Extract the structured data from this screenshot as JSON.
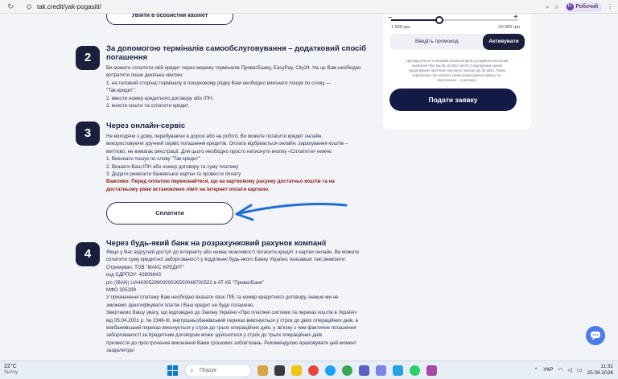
{
  "browser": {
    "url": "tak.credit/yak-pogasiti/",
    "profile_initial": "Н",
    "profile_label": "Робочий"
  },
  "top_button_label": "Увійти в особистий кабінет",
  "steps": [
    {
      "number": "2",
      "title_line1": "За допомогою терміналів самообслуговування – додатковий спосіб",
      "title_line2": "погашення",
      "lines": [
        "Ви можете сплатити свій кредит через мережу терміналів ПриватБанку, EasyPay, City24. На це Вам необхідно",
        "витратити лише декілька хвилин:",
        "1. на головній сторінці терміналу в пошуковому рядку Вам необхідно виконати пошук по слову —",
        "\"Так.кредит\";",
        "2. ввести номер кредитного договору або ІПН;",
        "3. внести кошти та сплатити кредит."
      ]
    },
    {
      "number": "3",
      "title_line1": "Через онлайн-сервіс",
      "lines": [
        "Не виходячи з дому, перебуваючи в дорозі або на роботі, Ви можете погасити кредит онлайн,",
        "використовуючи зручний сервіс погашення кредитів. Оплата відбувається онлайн, зарахування коштів –",
        "миттєво, не вимагає реєстрації. Для цього необхідно просто натиснути кнопку «Сплатити» нижче:",
        "1. Виконати пошук по слову \"Так кредит\"",
        "2. Вказати Ваш ІПН або номер договору та суму платежу",
        "3. Додати реквізити банківської картки та провести оплату"
      ],
      "warning_line1": "Важливо: Перед оплатою переконайтеся, що на картковому рахунку достатньо коштів та на",
      "warning_line2": "достатньому рівні встановлено ліміт на інтернет оплати карткою.",
      "pay_button": "Сплатити"
    },
    {
      "number": "4",
      "title_line1": "Через будь-який банк на розрахунковий рахунок компанії",
      "lines": [
        "Якщо у Вас відсутній доступ до інтернету або немає можливості погасити кредит з картки онлайн, Ви можете",
        "сплатити суму кредитної заборгованості у відділенні будь-якого Банку України, вказавши такі реквізити:",
        "Отримувач: ТОВ \"МАКС КРЕДИТ\"",
        "код ЄДРПОУ: 42806643",
        "р/с (IBAN) UA443052990000026500046700522 в АТ КБ \"ПриватБанк\"",
        "МФО 305299",
        "У призначенні платежу Вам необхідно вказати своє ПІБ та номер кредитного договору, інакше ми не",
        "зможемо ідентифікувати платіж і Ваш кредит не буде погашено.",
        "Звертаємо Вашу увагу, що відповідно до Закону України «Про платіжні системи та переказ коштів в Україні»",
        "від 05.04.2001 р. № 2346-ІІІ, внутрішньобанківський переказ виконується у строк до двох операційних днів, а",
        "міжбанківський переказ виконується у строк до трьох операційних днів, у зв'язку з чим фактичне погашення",
        "заборгованості за Кредитним договором може здійснитися у строк до трьох операційних днів",
        "призвести до прострочення виконання Вами грошових зобов'язань. Рекомендуємо враховувати цей момент",
        "заздалегідь!"
      ]
    }
  ],
  "card": {
    "range_min": "1 000 грн",
    "range_max": "10 000 грн",
    "slider_value_fraction": 0.38,
    "promo_label": "Введіть промокод",
    "promo_button": "Активувати",
    "disclaimer_lines": [
      "Цей відсоток не є кінцевим калькулятором у розумінні постанови",
      "правління НБУ від 05.10.2021 №100 та відображає умови",
      "кредитування протягом пільгового періоду (до 30 днів). Повну",
      "інформацію про загальні умови кредитування дивись тут,",
      "персональні – в договорі."
    ],
    "apply_button": "Подати заявку"
  },
  "taskbar": {
    "temp": "22°C",
    "weather": "Sunny",
    "search": "Пошук",
    "lang": "УКР",
    "time": "11:32",
    "date": "25.08.2026"
  },
  "colors": {
    "brand_navy": "#1a1f3d",
    "warning_red": "#8c1a1a",
    "annotation_arrow": "#1e6fd6"
  }
}
